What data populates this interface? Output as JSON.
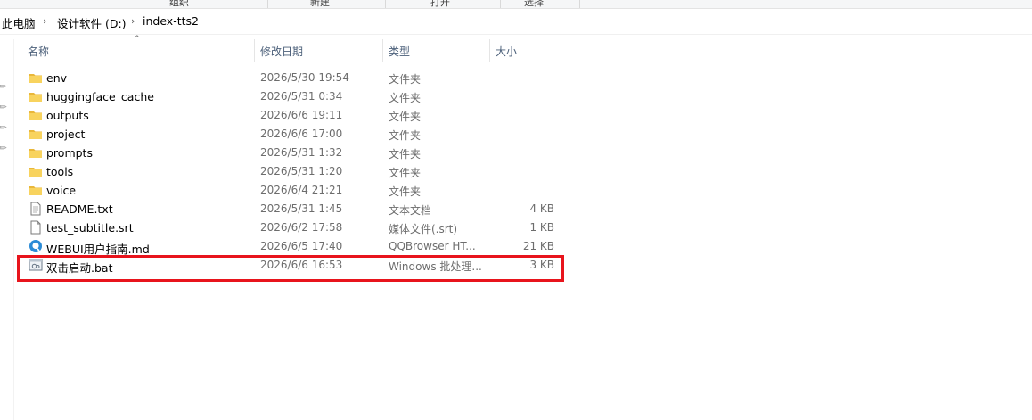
{
  "ribbon": {
    "labels": [
      "组织",
      "新建",
      "打开",
      "选择"
    ]
  },
  "breadcrumb": {
    "items": [
      "此电脑",
      "设计软件 (D:)",
      "index-tts2"
    ],
    "separator": "›"
  },
  "columns": {
    "name": "名称",
    "date": "修改日期",
    "type": "类型",
    "size": "大小",
    "sorted_by": "名称"
  },
  "files": [
    {
      "name": "env",
      "date": "2026/5/30 19:54",
      "type": "文件夹",
      "size": "",
      "icon": "folder-icon"
    },
    {
      "name": "huggingface_cache",
      "date": "2026/5/31 0:34",
      "type": "文件夹",
      "size": "",
      "icon": "folder-icon"
    },
    {
      "name": "outputs",
      "date": "2026/6/6 19:11",
      "type": "文件夹",
      "size": "",
      "icon": "folder-icon"
    },
    {
      "name": "project",
      "date": "2026/6/6 17:00",
      "type": "文件夹",
      "size": "",
      "icon": "folder-icon"
    },
    {
      "name": "prompts",
      "date": "2026/5/31 1:32",
      "type": "文件夹",
      "size": "",
      "icon": "folder-icon"
    },
    {
      "name": "tools",
      "date": "2026/5/31 1:20",
      "type": "文件夹",
      "size": "",
      "icon": "folder-icon"
    },
    {
      "name": "voice",
      "date": "2026/6/4 21:21",
      "type": "文件夹",
      "size": "",
      "icon": "folder-icon"
    },
    {
      "name": "README.txt",
      "date": "2026/5/31 1:45",
      "type": "文本文档",
      "size": "4 KB",
      "icon": "text-file-icon"
    },
    {
      "name": "test_subtitle.srt",
      "date": "2026/6/2 17:58",
      "type": "媒体文件(.srt)",
      "size": "1 KB",
      "icon": "blank-file-icon"
    },
    {
      "name": "WEBUI用户指南.md",
      "date": "2026/6/5 17:40",
      "type": "QQBrowser HT...",
      "size": "21 KB",
      "icon": "browser-file-icon"
    },
    {
      "name": "双击启动.bat",
      "date": "2026/6/6 16:53",
      "type": "Windows 批处理...",
      "size": "3 KB",
      "icon": "batch-file-icon"
    }
  ],
  "highlighted_file": "双击启动.bat",
  "colors": {
    "folder": "#f8d35e",
    "folder_dark": "#e9b73a",
    "highlight": "#e8141c",
    "header_text": "#4c607a"
  }
}
